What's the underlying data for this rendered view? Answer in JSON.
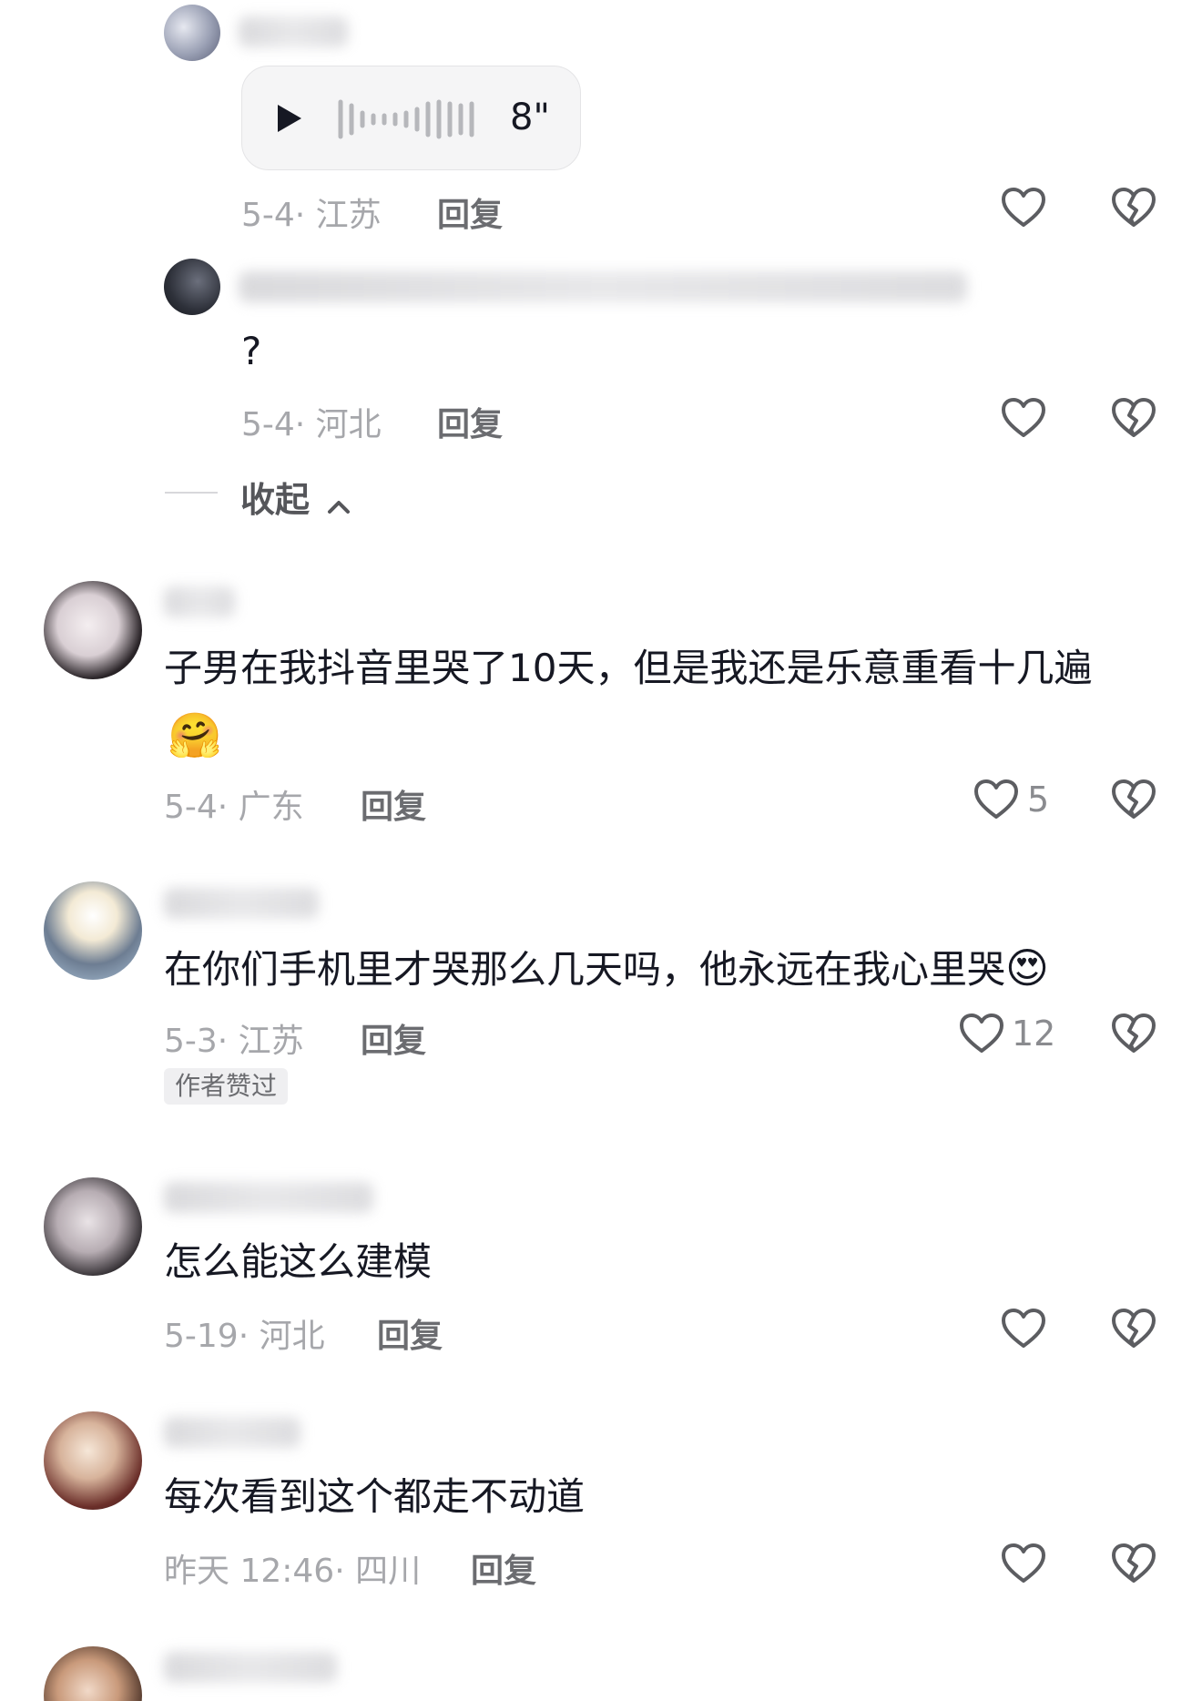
{
  "colors": {
    "text_primary": "#161823",
    "text_meta": "#a6a7ab",
    "text_reply": "#6b6c70",
    "background": "#ffffff",
    "icon_stroke": "#5c5d61"
  },
  "replies": [
    {
      "voice_duration": "8\"",
      "date_location": "5-4· 江苏",
      "reply_label": "回复"
    },
    {
      "text": "?",
      "date_location": "5-4· 河北",
      "reply_label": "回复"
    }
  ],
  "collapse_label": "收起",
  "comments": [
    {
      "text": "子男在我抖音里哭了10天，但是我还是乐意重看十几遍",
      "emoji": "🤗",
      "date_location": "5-4· 广东",
      "reply_label": "回复",
      "like_count": "5"
    },
    {
      "text": "在你们手机里才哭那么几天吗，他永远在我心里哭",
      "emoji": "😍",
      "date_location": "5-3· 江苏",
      "reply_label": "回复",
      "like_count": "12",
      "badge": "作者赞过"
    },
    {
      "text": "怎么能这么建模",
      "date_location": "5-19· 河北",
      "reply_label": "回复"
    },
    {
      "text": "每次看到这个都走不动道",
      "date_location": "昨天 12:46· 四川",
      "reply_label": "回复"
    }
  ],
  "icons": {
    "play": "play-icon",
    "waveform": "waveform-icon",
    "like": "heart-icon",
    "dislike": "broken-heart-icon",
    "collapse": "chevron-up-icon"
  }
}
